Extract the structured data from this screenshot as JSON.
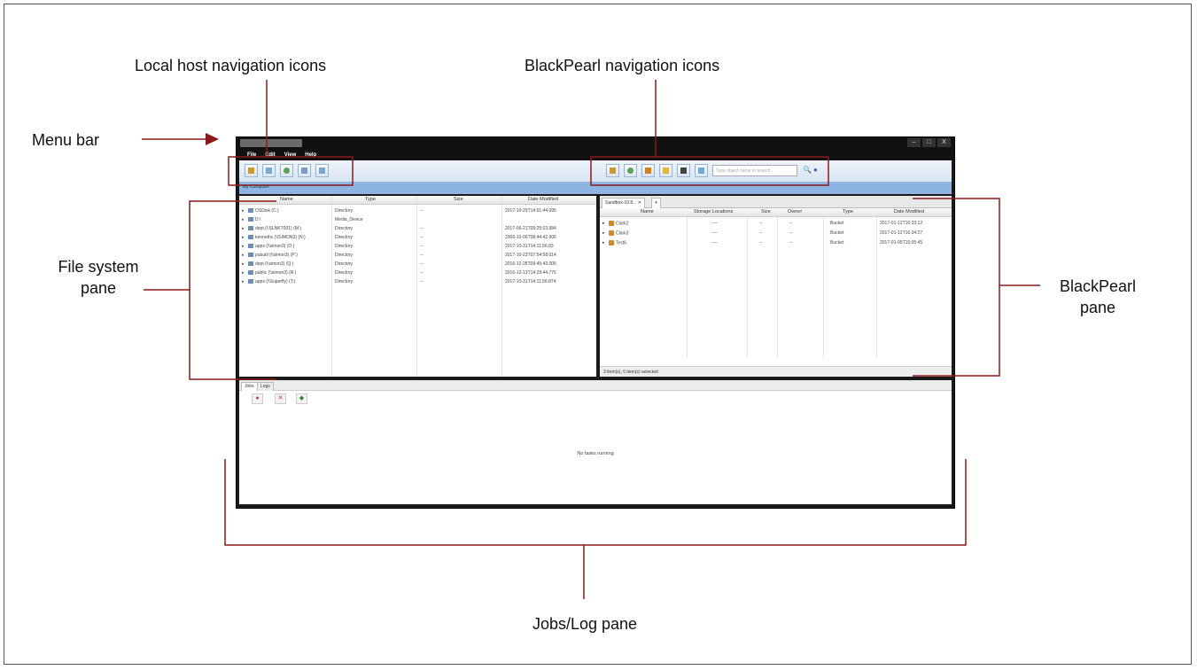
{
  "callouts": {
    "menu_bar": "Menu bar",
    "local_nav": "Local host navigation icons",
    "bp_nav": "BlackPearl navigation icons",
    "fs_pane_line1": "File system",
    "fs_pane_line2": "pane",
    "bp_pane_line1": "BlackPearl",
    "bp_pane_line2": "pane",
    "jobs_pane": "Jobs/Log pane"
  },
  "app": {
    "menu": [
      "File",
      "Edit",
      "View",
      "Help"
    ],
    "window_buttons": [
      "–",
      "□",
      "X"
    ],
    "local_header": "My Computer",
    "search_placeholder": "Type object name to search...",
    "file_columns": [
      "Name",
      "Type",
      "Size",
      "Date Modified"
    ],
    "file_rows": [
      {
        "name": "OSDisk (C:)",
        "type": "Directory",
        "size": "--",
        "date": "2017-10-29T14:01:44.095"
      },
      {
        "name": "D:\\",
        "type": "Media_Device",
        "size": "",
        "date": ""
      },
      {
        "name": "dept (\\\\SLNKT001) (M:)",
        "type": "Directory",
        "size": "--",
        "date": "2017-06-21T09:25:03.984"
      },
      {
        "name": "kennethc (\\\\SIMON3) (N:)",
        "type": "Directory",
        "size": "--",
        "date": "2006-10-06T08:44:42.906"
      },
      {
        "name": "apps (\\\\simon3) (O:)",
        "type": "Directory",
        "size": "--",
        "date": "2017-10-31T14:11:56.83"
      },
      {
        "name": "pubutil (\\\\simon3) (P:)",
        "type": "Directory",
        "size": "--",
        "date": "2017-10-23T07:54:58.014"
      },
      {
        "name": "dept (\\\\simon3) (Q:)",
        "type": "Directory",
        "size": "--",
        "date": "2016-12-28T09:45:43.005"
      },
      {
        "name": "public (\\\\simon3) (R:)",
        "type": "Directory",
        "size": "--",
        "date": "2016-12-13T14:29:44.776"
      },
      {
        "name": "apps (\\\\Superfly) (T:)",
        "type": "Directory",
        "size": "--",
        "date": "2017-10-31T14:11:56.874"
      }
    ],
    "bp_tab": "Sandbox-10.8...",
    "bp_columns": [
      "Name",
      "Storage Locations",
      "Size",
      "Owner",
      "Type",
      "Date Modified"
    ],
    "bp_rows": [
      {
        "name": "Clark2",
        "loc": "----",
        "size": "--",
        "owner": "--",
        "type": "Bucket",
        "date": "2017-01-12T16:33:12"
      },
      {
        "name": "Clark3",
        "loc": "----",
        "size": "--",
        "owner": "--",
        "type": "Bucket",
        "date": "2017-01-12T16:34:27"
      },
      {
        "name": "Test6",
        "loc": "----",
        "size": "--",
        "owner": "--",
        "type": "Bucket",
        "date": "2017-01-05T15:05:45"
      }
    ],
    "bp_status": "3 item(s), 0 item(s) selected",
    "jobs_tabs": [
      "Jobs",
      "Logs"
    ],
    "jobs_empty": "No tasks running"
  }
}
